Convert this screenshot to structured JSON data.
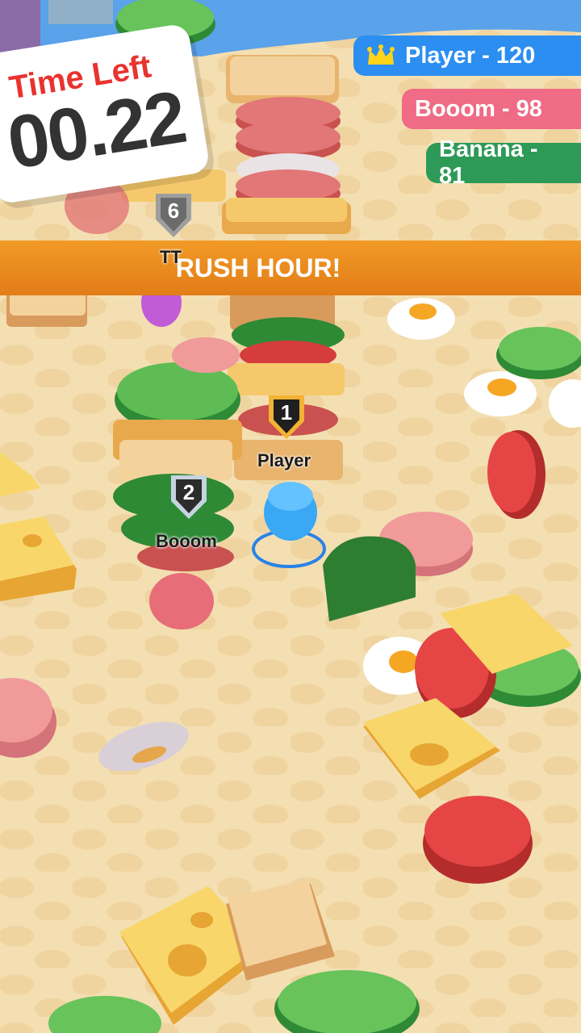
{
  "timer": {
    "label": "Time Left",
    "value": "00.22"
  },
  "leaderboard": [
    {
      "rank_icon": "crown-icon",
      "text": "Player - 120",
      "color": "#2b8ef0"
    },
    {
      "text": "Booom - 98",
      "color": "#ef6b86"
    },
    {
      "text": "Banana - 81",
      "color": "#2d9a57"
    }
  ],
  "banner": {
    "text": "RUSH HOUR!",
    "color": "#ee8f20"
  },
  "players": [
    {
      "rank": "6",
      "name": "TT"
    },
    {
      "rank": "1",
      "name": "Player"
    },
    {
      "rank": "2",
      "name": "Booom"
    }
  ]
}
